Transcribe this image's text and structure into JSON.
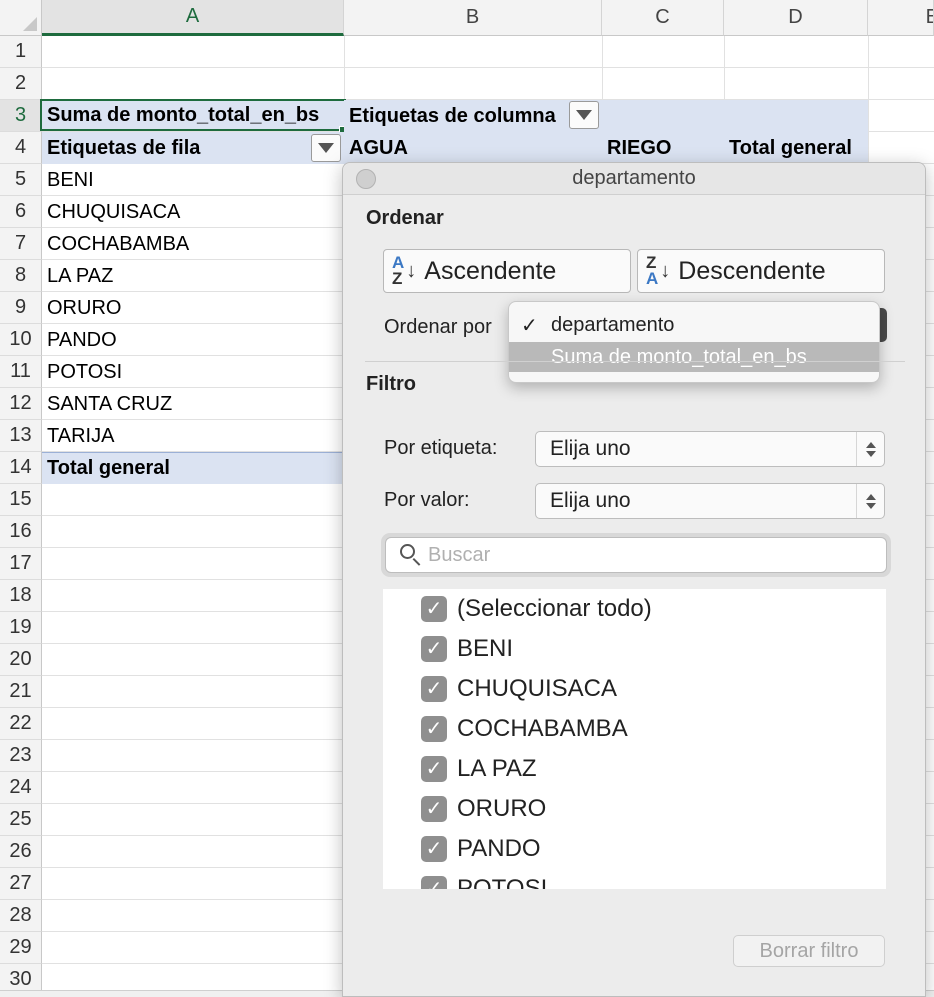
{
  "columns": [
    "A",
    "B",
    "C",
    "D",
    "E"
  ],
  "rows": [
    "1",
    "2",
    "3",
    "4",
    "5",
    "6",
    "7",
    "8",
    "9",
    "10",
    "11",
    "12",
    "13",
    "14",
    "15",
    "16",
    "17",
    "18",
    "19",
    "20",
    "21",
    "22",
    "23",
    "24",
    "25",
    "26",
    "27",
    "28",
    "29",
    "30"
  ],
  "pivot": {
    "value_header": "Suma de monto_total_en_bs",
    "column_labels_header": "Etiquetas de columna",
    "row_labels_header": "Etiquetas de fila",
    "col_agua": "AGUA",
    "col_riego": "RIEGO",
    "col_total": "Total general",
    "row_items": [
      "BENI",
      "CHUQUISACA",
      "COCHABAMBA",
      "LA PAZ",
      "ORURO",
      "PANDO",
      "POTOSI",
      "SANTA CRUZ",
      "TARIJA"
    ],
    "total_row": "Total general"
  },
  "filter_panel": {
    "title": "departamento",
    "sort_section": "Ordenar",
    "ascending_label": "Ascendente",
    "descending_label": "Descendente",
    "az_top": "A",
    "az_bottom": "Z",
    "za_top": "Z",
    "za_bottom": "A",
    "sort_by_label": "Ordenar por",
    "sort_by_options": [
      {
        "label": "departamento",
        "checked": "✓"
      },
      {
        "label": "Suma de monto_total_en_bs",
        "checked": ""
      }
    ],
    "filter_section": "Filtro",
    "by_label_label": "Por etiqueta:",
    "by_label_value": "Elija uno",
    "by_value_label": "Por valor:",
    "by_value_value": "Elija uno",
    "search_placeholder": "Buscar",
    "items": [
      "(Seleccionar todo)",
      "BENI",
      "CHUQUISACA",
      "COCHABAMBA",
      "LA PAZ",
      "ORURO",
      "PANDO",
      "POTOSI"
    ],
    "clear_filter_label": "Borrar filtro"
  },
  "colors": {
    "accent_green": "#1e6b3e",
    "pivot_blue": "#dbe3f2"
  }
}
